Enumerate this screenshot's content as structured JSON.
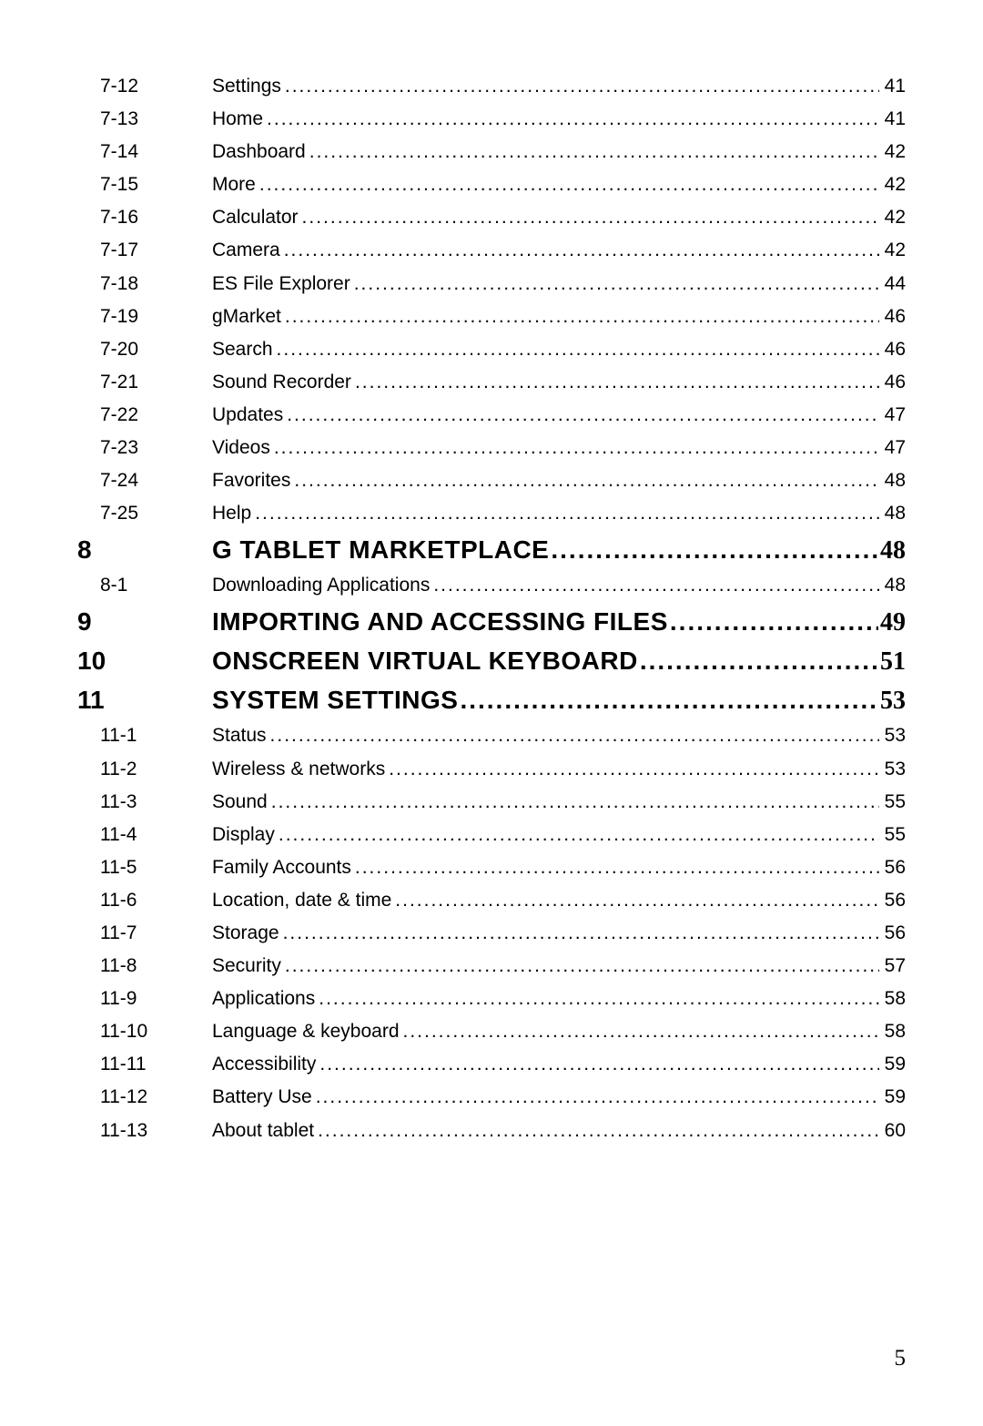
{
  "entries": [
    {
      "type": "sub",
      "num": "7-12",
      "title": "Settings",
      "page": "41"
    },
    {
      "type": "sub",
      "num": "7-13",
      "title": "Home",
      "page": "41"
    },
    {
      "type": "sub",
      "num": "7-14",
      "title": "Dashboard",
      "page": "42"
    },
    {
      "type": "sub",
      "num": "7-15",
      "title": "More",
      "page": "42"
    },
    {
      "type": "sub",
      "num": "7-16",
      "title": "Calculator",
      "page": "42"
    },
    {
      "type": "sub",
      "num": "7-17",
      "title": "Camera",
      "page": "42"
    },
    {
      "type": "sub",
      "num": "7-18",
      "title": "ES File Explorer",
      "page": "44"
    },
    {
      "type": "sub",
      "num": "7-19",
      "title": "gMarket",
      "page": "46"
    },
    {
      "type": "sub",
      "num": "7-20",
      "title": "Search",
      "page": "46"
    },
    {
      "type": "sub",
      "num": "7-21",
      "title": "Sound Recorder",
      "page": "46"
    },
    {
      "type": "sub",
      "num": "7-22",
      "title": "Updates",
      "page": "47"
    },
    {
      "type": "sub",
      "num": "7-23",
      "title": "Videos",
      "page": "47"
    },
    {
      "type": "sub",
      "num": "7-24",
      "title": "Favorites",
      "page": "48"
    },
    {
      "type": "sub",
      "num": "7-25",
      "title": "Help",
      "page": "48"
    },
    {
      "type": "chapter",
      "num": "8",
      "title": "G TABLET MARKETPLACE",
      "page": "48"
    },
    {
      "type": "sub",
      "num": "8-1",
      "title": "Downloading Applications",
      "page": "48"
    },
    {
      "type": "chapter",
      "num": "9",
      "title": "IMPORTING AND ACCESSING FILES",
      "page": "49"
    },
    {
      "type": "chapter",
      "num": "10",
      "title": "ONSCREEN VIRTUAL KEYBOARD",
      "page": "51"
    },
    {
      "type": "chapter",
      "num": "11",
      "title": "SYSTEM SETTINGS",
      "page": "53"
    },
    {
      "type": "sub",
      "num": "11-1",
      "title": "Status",
      "page": "53"
    },
    {
      "type": "sub",
      "num": "11-2",
      "title": "Wireless & networks",
      "page": "53"
    },
    {
      "type": "sub",
      "num": "11-3",
      "title": "Sound",
      "page": "55"
    },
    {
      "type": "sub",
      "num": "11-4",
      "title": "Display",
      "page": "55"
    },
    {
      "type": "sub",
      "num": "11-5",
      "title": "Family Accounts",
      "page": "56"
    },
    {
      "type": "sub",
      "num": "11-6",
      "title": "Location, date & time",
      "page": "56"
    },
    {
      "type": "sub",
      "num": "11-7",
      "title": "Storage",
      "page": "56"
    },
    {
      "type": "sub",
      "num": "11-8",
      "title": "Security",
      "page": "57"
    },
    {
      "type": "sub",
      "num": "11-9",
      "title": "Applications",
      "page": "58"
    },
    {
      "type": "sub",
      "num": "11-10",
      "title": "Language & keyboard",
      "page": "58"
    },
    {
      "type": "sub",
      "num": "11-11",
      "title": "Accessibility",
      "page": "59"
    },
    {
      "type": "sub",
      "num": "11-12",
      "title": "Battery Use",
      "page": "59"
    },
    {
      "type": "sub",
      "num": "11-13",
      "title": "About tablet",
      "page": "60"
    }
  ],
  "page_number": "5"
}
